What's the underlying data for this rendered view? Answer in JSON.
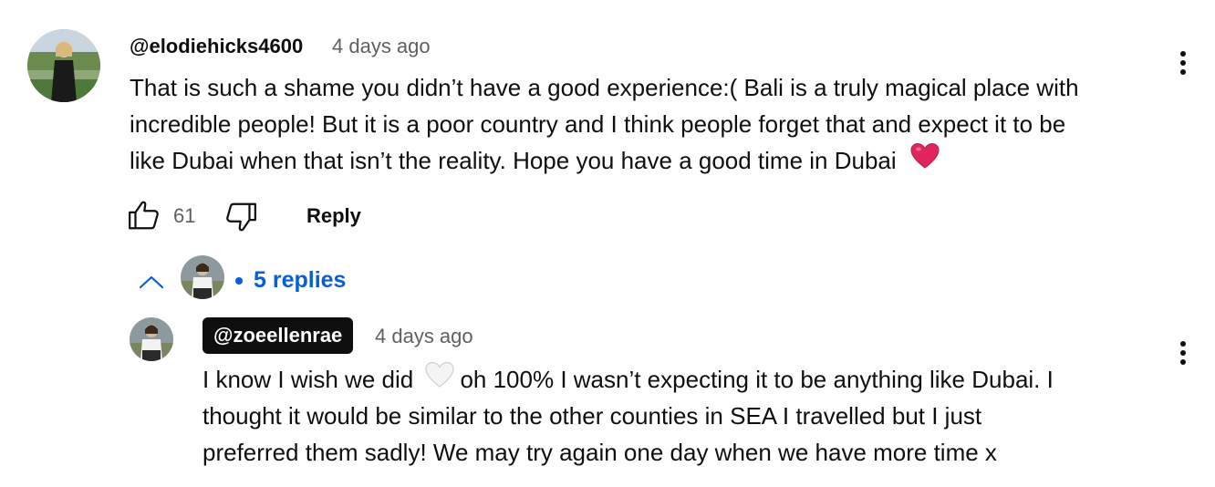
{
  "comment": {
    "username": "@elodiehicks4600",
    "timestamp": "4 days ago",
    "text_lines": [
      "That is such a shame you didn’t have a good experience:( Bali is a truly magical place with",
      "incredible people! But it is a poor country and I think people forget that and expect it to be",
      "like Dubai when that isn’t the reality. Hope you have a good time in Dubai"
    ],
    "emoji": "red-heart",
    "likes": "61",
    "reply_label": "Reply",
    "replies_label": "5 replies",
    "toggle_icon": "chevron-up-icon",
    "menu_icon": "more-vert-icon"
  },
  "reply": {
    "username": "@zoeellenrae",
    "timestamp": "4 days ago",
    "text_line1_a": "I know I wish we did",
    "text_line1_emoji": "white-heart",
    "text_line1_b": "oh 100% I wasn’t expecting it to be anything like Dubai. I",
    "text_line2": "thought it would be similar to the other counties in SEA I travelled but I just",
    "text_line3": "preferred them sadly! We may try again one day when we have more time x",
    "menu_icon": "more-vert-icon"
  },
  "colors": {
    "link_blue": "#065fd4",
    "text_primary": "#0f0f0f",
    "text_secondary": "#606060",
    "heart_red": "#e0245e"
  }
}
